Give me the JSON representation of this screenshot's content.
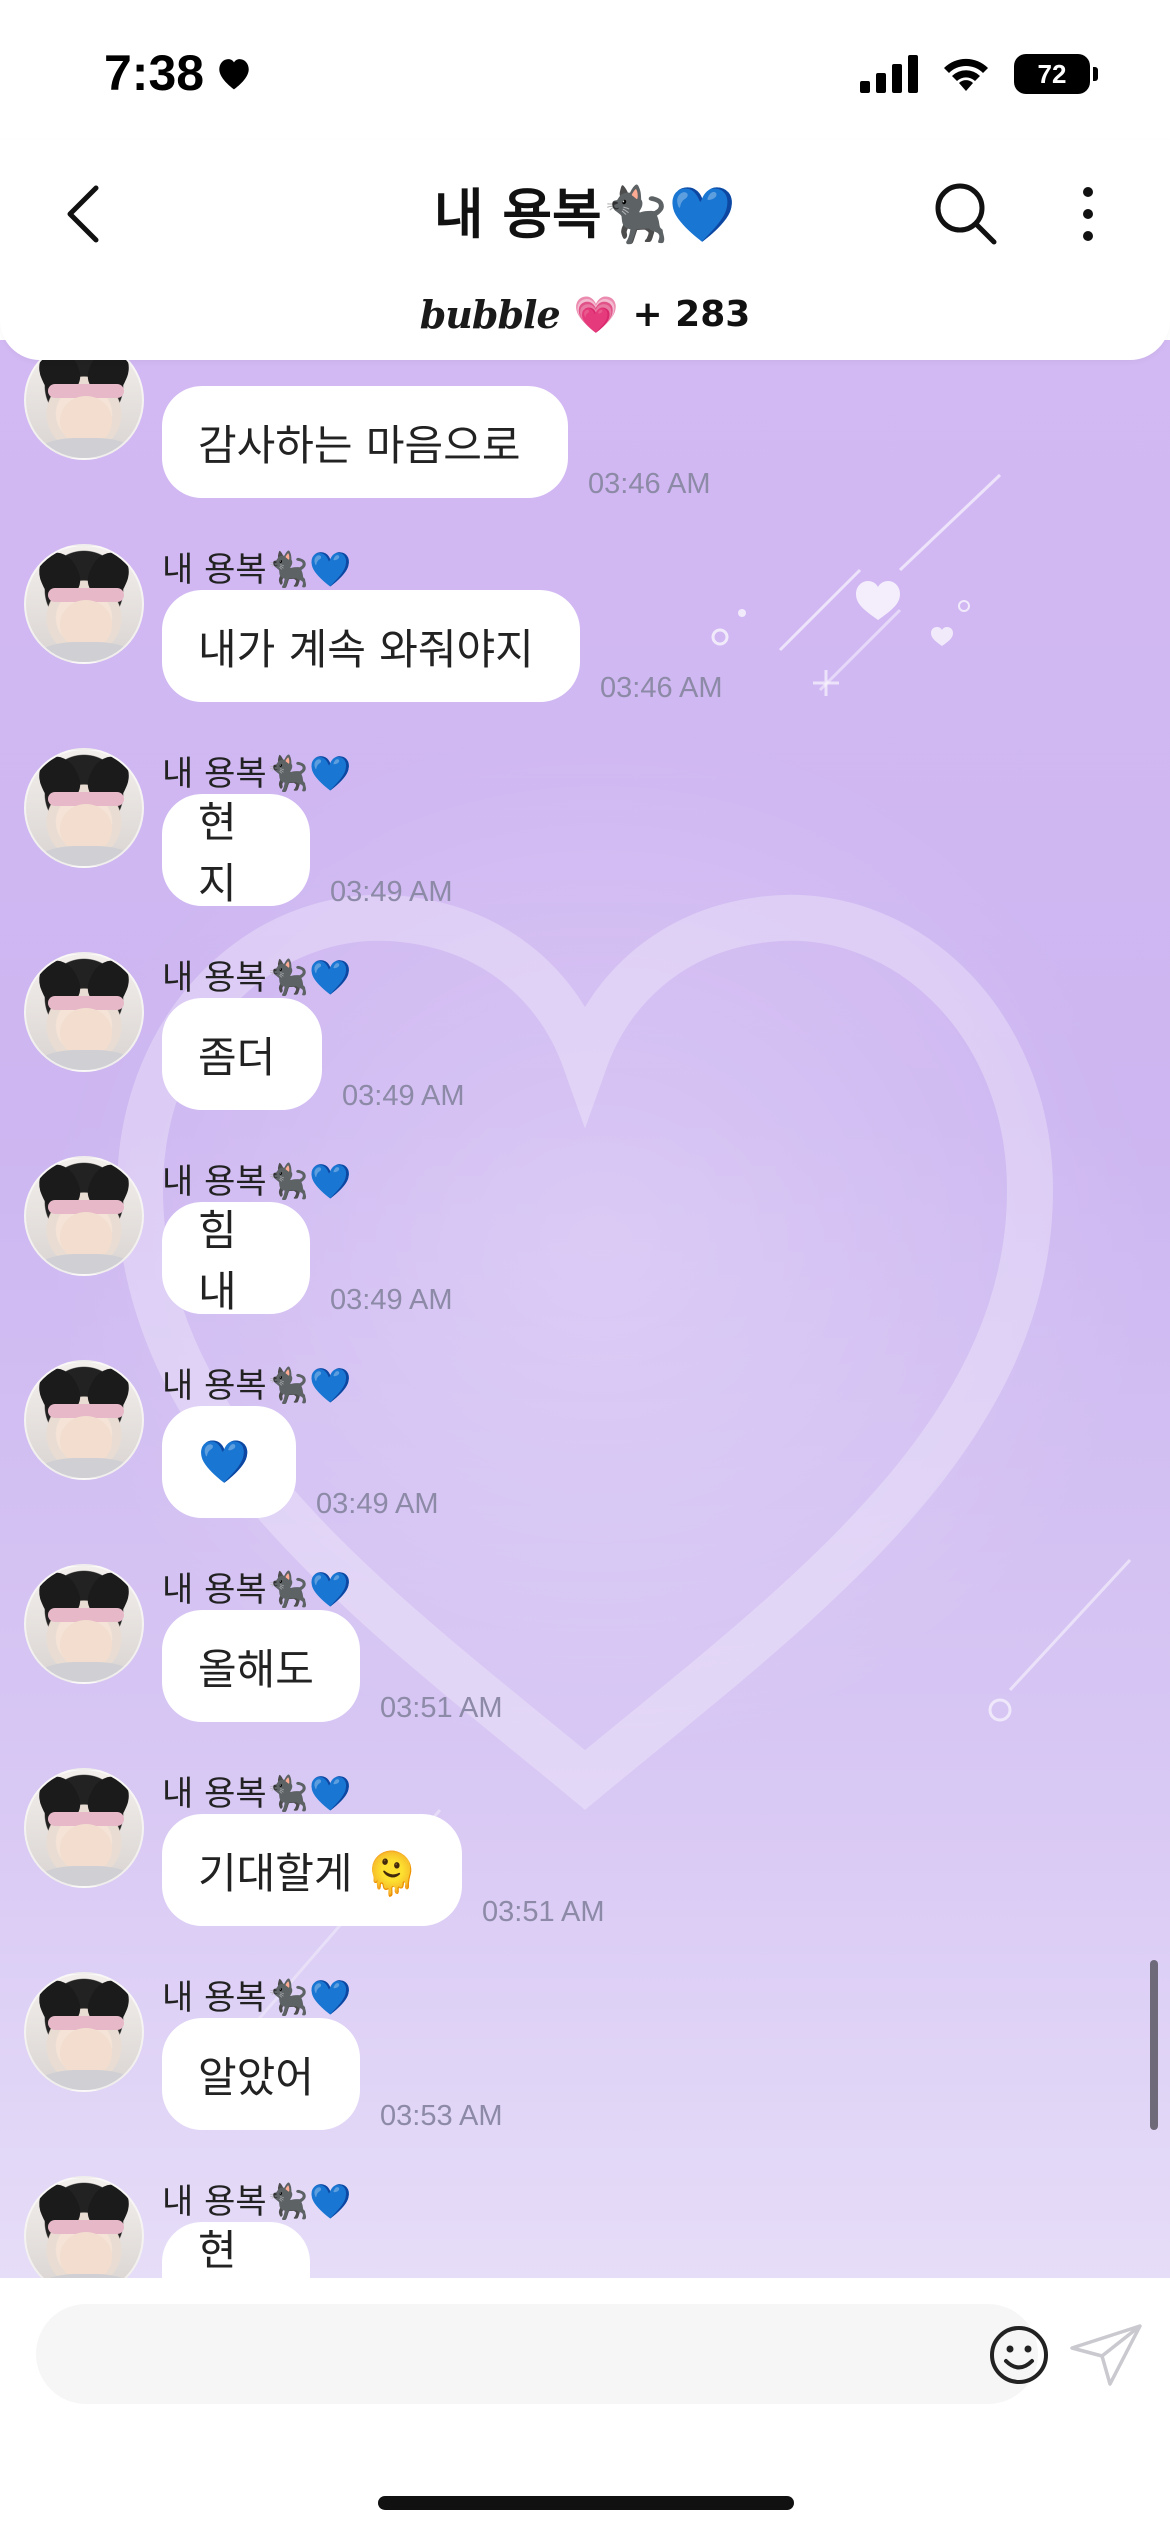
{
  "status_bar": {
    "time": "7:38",
    "battery": "72"
  },
  "header": {
    "title": "내 용복🐈‍⬛💙",
    "brand": "bubble",
    "brand_heart": "💗",
    "count": "+ 283",
    "icons": [
      "back-icon",
      "search-icon",
      "more-icon"
    ]
  },
  "sender_name": "내 용복🐈‍⬛💙",
  "messages": [
    {
      "text": "감사하는 마음으로",
      "time": "03:46 AM"
    },
    {
      "text": "내가 계속 와줘야지",
      "time": "03:46 AM"
    },
    {
      "text": "현지",
      "time": "03:49 AM"
    },
    {
      "text": "좀더",
      "time": "03:49 AM"
    },
    {
      "text": "힘내",
      "time": "03:49 AM"
    },
    {
      "text": "💙",
      "time": "03:49 AM"
    },
    {
      "text": "올해도",
      "time": "03:51 AM"
    },
    {
      "text": "기대할게 🫠",
      "time": "03:51 AM"
    },
    {
      "text": "알았어",
      "time": "03:53 AM"
    },
    {
      "text": "현지",
      "time": ""
    }
  ],
  "input": {
    "placeholder": ""
  },
  "colors": {
    "chat_bg_top": "#d3b9f3",
    "chat_bg_bottom": "#e6ddf8",
    "time_text": "#8c8aa6"
  }
}
